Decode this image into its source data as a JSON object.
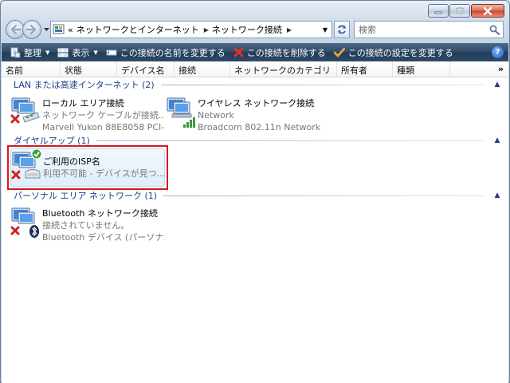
{
  "address": {
    "prefix": "«",
    "crumbs": [
      "ネットワークとインターネット",
      "ネットワーク接続"
    ]
  },
  "search": {
    "placeholder": "検索"
  },
  "toolbar": {
    "organize": "整理",
    "views": "表示",
    "rename": "この接続の名前を変更する",
    "delete": "この接続を削除する",
    "change_settings": "この接続の設定を変更する",
    "help": "?"
  },
  "columns": [
    "名前",
    "状態",
    "デバイス名",
    "接続",
    "ネットワークのカテゴリ",
    "所有者",
    "種類"
  ],
  "columns_more": "»",
  "groups": [
    {
      "title": "LAN または高速インターネット (2)",
      "items": [
        {
          "name": "ローカル エリア接続",
          "status": "ネットワーク ケーブルが接続...",
          "device": "Marvell Yukon 88E8058 PCI-..."
        },
        {
          "name": "ワイヤレス ネットワーク接続",
          "status": "Network",
          "device": "Broadcom 802.11n Network..."
        }
      ]
    },
    {
      "title": "ダイヤルアップ (1)",
      "items": [
        {
          "name": "ご利用のISP名",
          "status": "利用不可能 - デバイスが見つ..."
        }
      ]
    },
    {
      "title": "パーソナル エリア ネットワーク (1)",
      "items": [
        {
          "name": "Bluetooth ネットワーク接続",
          "status": "接続されていません。",
          "device": "Bluetooth デバイス (パーソナ..."
        }
      ]
    }
  ],
  "colors": {
    "toolbar_bg": "#2f4a66",
    "group_title": "#1e3d8f",
    "highlight_border": "#d4191c",
    "error_x": "#d21f1f"
  }
}
